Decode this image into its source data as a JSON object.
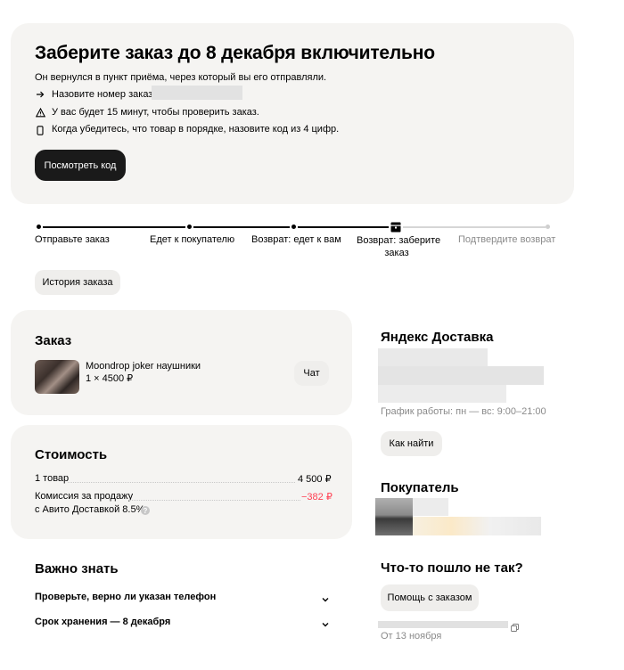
{
  "pickup": {
    "title": "Заберите заказ до 8 декабря включительно",
    "subtitle": "Он вернулся в пункт приёма, через который вы его отправляли.",
    "rows": [
      {
        "icon": "arrow-right-icon",
        "text": "Назовите номер заказа"
      },
      {
        "icon": "warning-icon",
        "text": "У вас будет 15 минут, чтобы проверить заказ."
      },
      {
        "icon": "phone-icon",
        "text": "Когда убедитесь, что товар в порядке, назовите код из 4 цифр."
      }
    ],
    "show_code_button": "Посмотреть код"
  },
  "progress": {
    "steps": [
      {
        "label": "Отправьте заказ",
        "done": true
      },
      {
        "label": "Едет к покупателю",
        "done": true
      },
      {
        "label": "Возврат: едет к вам",
        "done": true
      },
      {
        "label": "Возврат: заберите заказ",
        "label_line1": "Возврат: заберите",
        "label_line2": "заказ",
        "current": true
      },
      {
        "label": "Подтвердите возврат",
        "done": false
      }
    ]
  },
  "history_button": "История заказа",
  "order": {
    "title": "Заказ",
    "item_name": "Moondrop joker наушники",
    "item_qty": "1 × 4500 ₽",
    "chat_button": "Чат"
  },
  "cost": {
    "title": "Стоимость",
    "rows": [
      {
        "label": "1 товар",
        "value": "4 500 ₽"
      },
      {
        "label": "Комиссия за продажу",
        "label2": "с Авито Доставкой 8.5%",
        "value": "−382 ₽",
        "value_color": "#ff4053"
      }
    ]
  },
  "important": {
    "title": "Важно знать",
    "items": [
      "Проверьте, верно ли указан телефон",
      "Срок хранения — 8 декабря"
    ]
  },
  "delivery": {
    "title": "Яндекс Доставка",
    "schedule": "График работы: пн — вс: 9:00–21:00",
    "find_button": "Как найти"
  },
  "buyer": {
    "title": "Покупатель"
  },
  "problem": {
    "title": "Что-то пошло не так?",
    "help_button": "Помощь с заказом",
    "date": "От 13 ноября"
  },
  "colors": {
    "card_bg": "#f5f4f2",
    "dark_button": "#1a1a1a",
    "negative": "#ff4053",
    "muted": "#8a8a8a"
  }
}
